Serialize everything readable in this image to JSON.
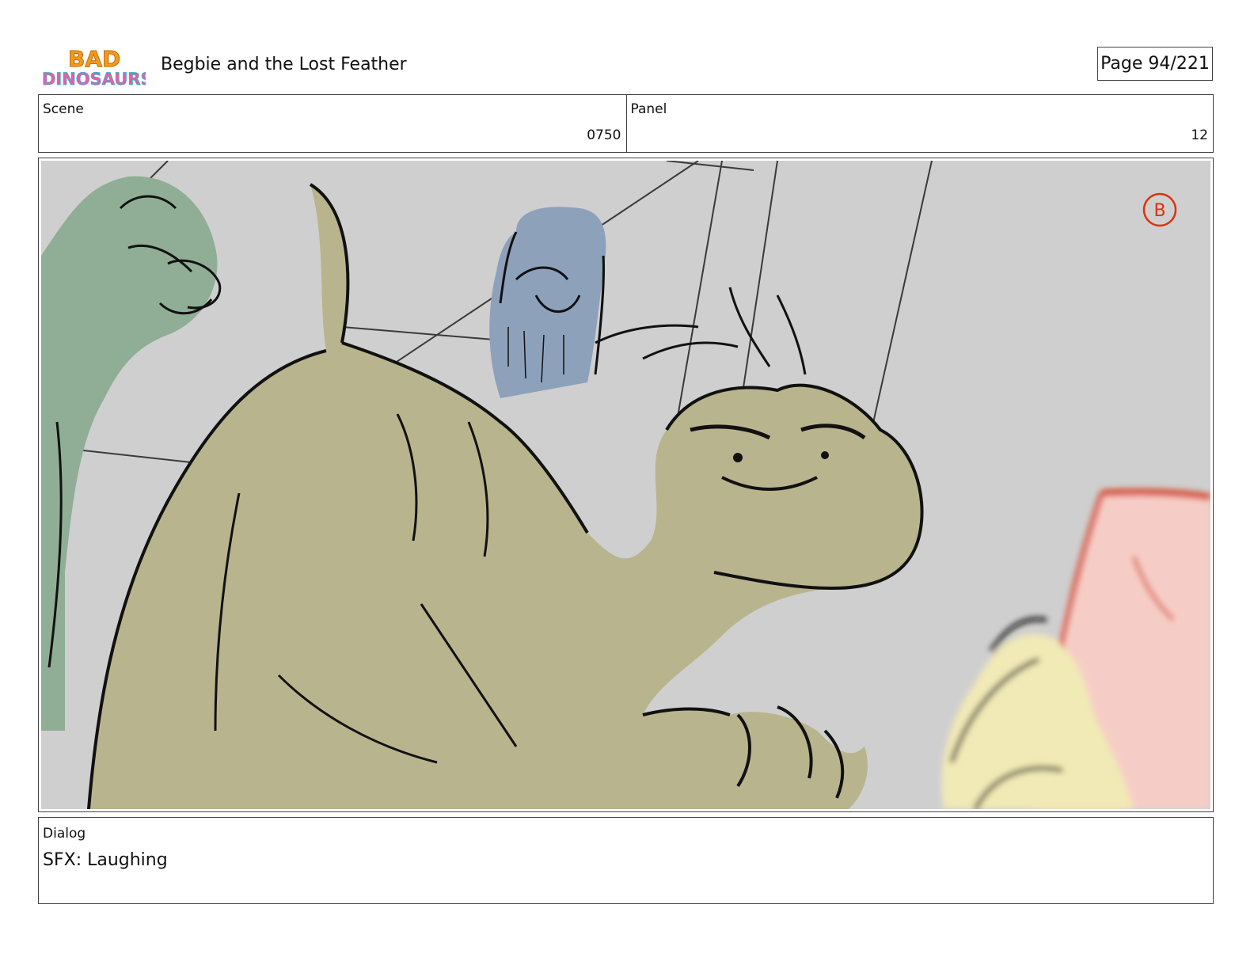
{
  "header": {
    "logo_text_line1": "BAD",
    "logo_text_line2": "DINOSAURS",
    "title": "Begbie and the Lost Feather",
    "page_label": "Page",
    "page_number": "94/221"
  },
  "info": {
    "scene_label": "Scene",
    "scene_value": "0750",
    "panel_label": "Panel",
    "panel_value": "12"
  },
  "storyboard_panel": {
    "corner_mark": "B",
    "colors": {
      "background": "#cfcfcf",
      "main_dinosaur": "#b8b58e",
      "green_dinosaur": "#8fae95",
      "blue_character": "#8ea1bb",
      "pink_character": "#f6cdc6",
      "yellow_character": "#f1e9b6",
      "red_line": "#d8340f",
      "ink": "#111111"
    }
  },
  "dialog": {
    "label": "Dialog",
    "text": "SFX: Laughing"
  }
}
